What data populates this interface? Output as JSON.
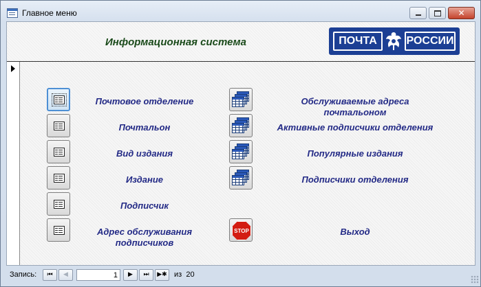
{
  "window": {
    "title": "Главное меню"
  },
  "header": {
    "title": "Информационная система",
    "logo": {
      "left_text": "ПОЧТА",
      "right_text": "РОССИИ"
    }
  },
  "form_buttons": [
    {
      "label": "Почтовое отделение",
      "icon": "form-icon"
    },
    {
      "label": "Почтальон",
      "icon": "form-icon"
    },
    {
      "label": "Вид издания",
      "icon": "form-icon"
    },
    {
      "label": "Издание",
      "icon": "form-icon"
    },
    {
      "label": "Подписчик",
      "icon": "form-icon"
    },
    {
      "label": "Адрес обслуживания подписчиков",
      "icon": "form-icon"
    }
  ],
  "report_buttons": [
    {
      "label": "Обслуживаемые адреса почтальоном",
      "icon": "report-icon"
    },
    {
      "label": "Активные подписчики отделения",
      "icon": "report-icon"
    },
    {
      "label": "Популярные издания",
      "icon": "report-icon"
    },
    {
      "label": "Подписчики отделения",
      "icon": "report-icon"
    }
  ],
  "exit_button": {
    "label": "Выход",
    "icon": "stop-icon",
    "icon_text": "STOP"
  },
  "navigation": {
    "label": "Запись:",
    "current": "1",
    "of_label": "из",
    "total": "20"
  },
  "colors": {
    "label_text": "#232a86",
    "title_text": "#1a4a1a",
    "logo_background": "#1c3f94",
    "stop_red": "#d31d12"
  }
}
